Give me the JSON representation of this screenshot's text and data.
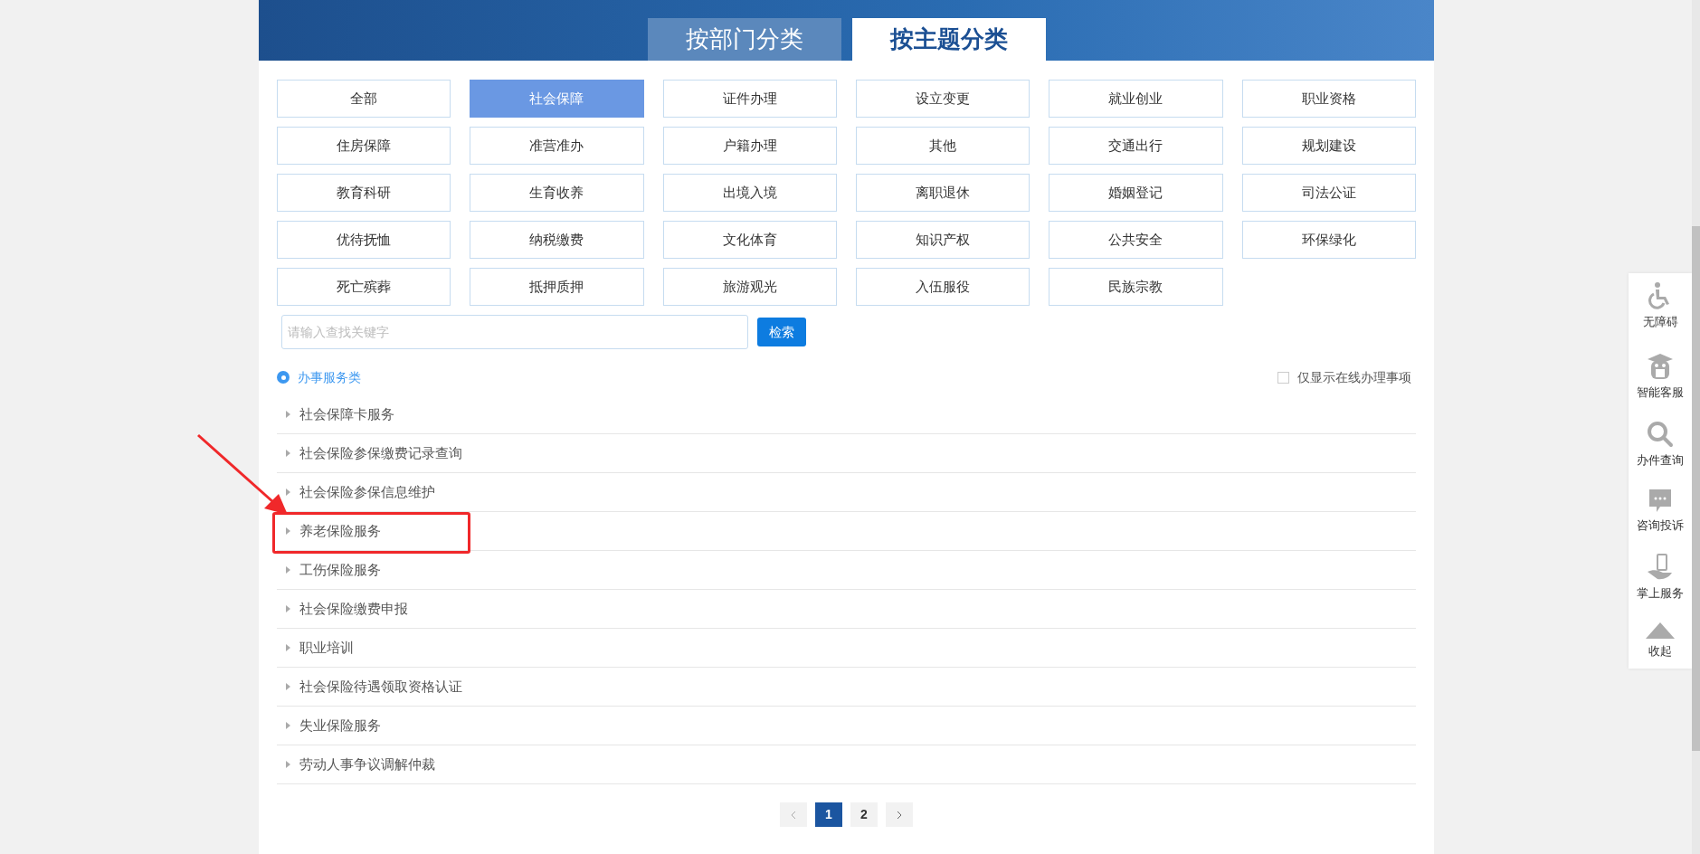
{
  "tabs": [
    {
      "label": "按部门分类",
      "selected": false
    },
    {
      "label": "按主题分类",
      "selected": true
    }
  ],
  "categories": [
    {
      "label": "全部",
      "selected": false
    },
    {
      "label": "社会保障",
      "selected": true
    },
    {
      "label": "证件办理",
      "selected": false
    },
    {
      "label": "设立变更",
      "selected": false
    },
    {
      "label": "就业创业",
      "selected": false
    },
    {
      "label": "职业资格",
      "selected": false
    },
    {
      "label": "住房保障",
      "selected": false
    },
    {
      "label": "准营准办",
      "selected": false
    },
    {
      "label": "户籍办理",
      "selected": false
    },
    {
      "label": "其他",
      "selected": false
    },
    {
      "label": "交通出行",
      "selected": false
    },
    {
      "label": "规划建设",
      "selected": false
    },
    {
      "label": "教育科研",
      "selected": false
    },
    {
      "label": "生育收养",
      "selected": false
    },
    {
      "label": "出境入境",
      "selected": false
    },
    {
      "label": "离职退休",
      "selected": false
    },
    {
      "label": "婚姻登记",
      "selected": false
    },
    {
      "label": "司法公证",
      "selected": false
    },
    {
      "label": "优待抚恤",
      "selected": false
    },
    {
      "label": "纳税缴费",
      "selected": false
    },
    {
      "label": "文化体育",
      "selected": false
    },
    {
      "label": "知识产权",
      "selected": false
    },
    {
      "label": "公共安全",
      "selected": false
    },
    {
      "label": "环保绿化",
      "selected": false
    },
    {
      "label": "死亡殡葬",
      "selected": false
    },
    {
      "label": "抵押质押",
      "selected": false
    },
    {
      "label": "旅游观光",
      "selected": false
    },
    {
      "label": "入伍服役",
      "selected": false
    },
    {
      "label": "民族宗教",
      "selected": false
    }
  ],
  "search": {
    "placeholder": "请输入查找关键字",
    "button": "检索"
  },
  "service_type": {
    "label": "办事服务类",
    "selected": true
  },
  "online_only": {
    "label": "仅显示在线办理事项",
    "checked": false
  },
  "items": [
    {
      "label": "社会保障卡服务",
      "highlighted": false
    },
    {
      "label": "社会保险参保缴费记录查询",
      "highlighted": false
    },
    {
      "label": "社会保险参保信息维护",
      "highlighted": false
    },
    {
      "label": "养老保险服务",
      "highlighted": true
    },
    {
      "label": "工伤保险服务",
      "highlighted": false
    },
    {
      "label": "社会保险缴费申报",
      "highlighted": false
    },
    {
      "label": "职业培训",
      "highlighted": false
    },
    {
      "label": "社会保险待遇领取资格认证",
      "highlighted": false
    },
    {
      "label": "失业保险服务",
      "highlighted": false
    },
    {
      "label": "劳动人事争议调解仲裁",
      "highlighted": false
    }
  ],
  "pagination": {
    "pages": [
      {
        "label": "1",
        "selected": true
      },
      {
        "label": "2",
        "selected": false
      }
    ]
  },
  "sidebar": [
    {
      "kind": "wheelchair",
      "label": "无障碍"
    },
    {
      "kind": "robot",
      "label": "智能客服"
    },
    {
      "kind": "search",
      "label": "办件查询"
    },
    {
      "kind": "chat",
      "label": "咨询投诉"
    },
    {
      "kind": "phone",
      "label": "掌上服务"
    },
    {
      "kind": "collapse",
      "label": "收起"
    }
  ]
}
